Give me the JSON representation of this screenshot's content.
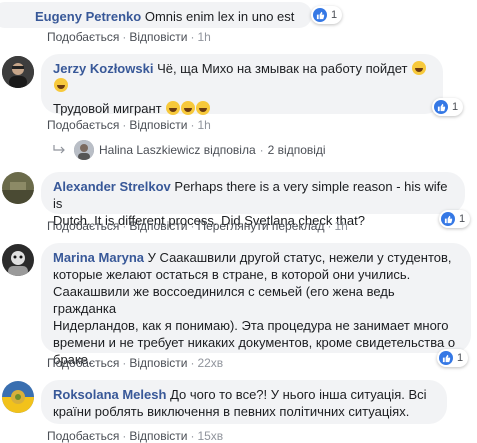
{
  "comments": [
    {
      "author": "Eugeny Petrenko",
      "text": "Omnis enim lex in uno est",
      "like_count": "1",
      "actions": {
        "like": "Подобається",
        "reply": "Відповісти",
        "time": "1h"
      }
    },
    {
      "author": "Jerzy Kozłowski",
      "text_line1": "Чё, ща Михо на змывак на работу пойдет",
      "text_line2": "Трудовой мигрант",
      "like_count": "1",
      "actions": {
        "like": "Подобається",
        "reply": "Відповісти",
        "time": "1h"
      },
      "reply_summary": {
        "replier": "Halina Laszkiewicz",
        "verb": "відповіла",
        "count": "2 відповіді"
      }
    },
    {
      "author": "Alexander Strelkov",
      "text_line1": "Perhaps there is a very simple reason - his wife is",
      "text_line2": "Dutch. It is different process. Did Svetlana check that?",
      "like_count": "1",
      "actions": {
        "like": "Подобається",
        "reply": "Відповісти",
        "translate": "Переглянути переклад",
        "time": "1h"
      }
    },
    {
      "author": "Marina Maryna",
      "text_line1": "У Саакашвили другой статус, нежели у студентов,",
      "text_line2": "которые желают остаться в стране, в которой они учились.",
      "text_line3": "Саакашвили же воссоединился с семьей (его жена ведь гражданка",
      "text_line4": "Нидерландов, как я понимаю). Эта процедура не занимает много",
      "text_line5": "времени и не требует никаких документов, кроме свидетельства о",
      "text_line6": "браке.",
      "like_count": "1",
      "actions": {
        "like": "Подобається",
        "reply": "Відповісти",
        "time": "22хв"
      }
    },
    {
      "author": "Roksolana Melesh",
      "text_line1": "До чого то все?! У нього інша ситуація. Всі",
      "text_line2": "країни роблять виключення в певних політичних ситуаціях.",
      "actions": {
        "like": "Подобається",
        "reply": "Відповісти",
        "time": "15хв"
      }
    }
  ],
  "colors": {
    "name": "#385898",
    "bubble": "#f2f3f5",
    "like": "#3578e5",
    "meta": "#90949c"
  }
}
